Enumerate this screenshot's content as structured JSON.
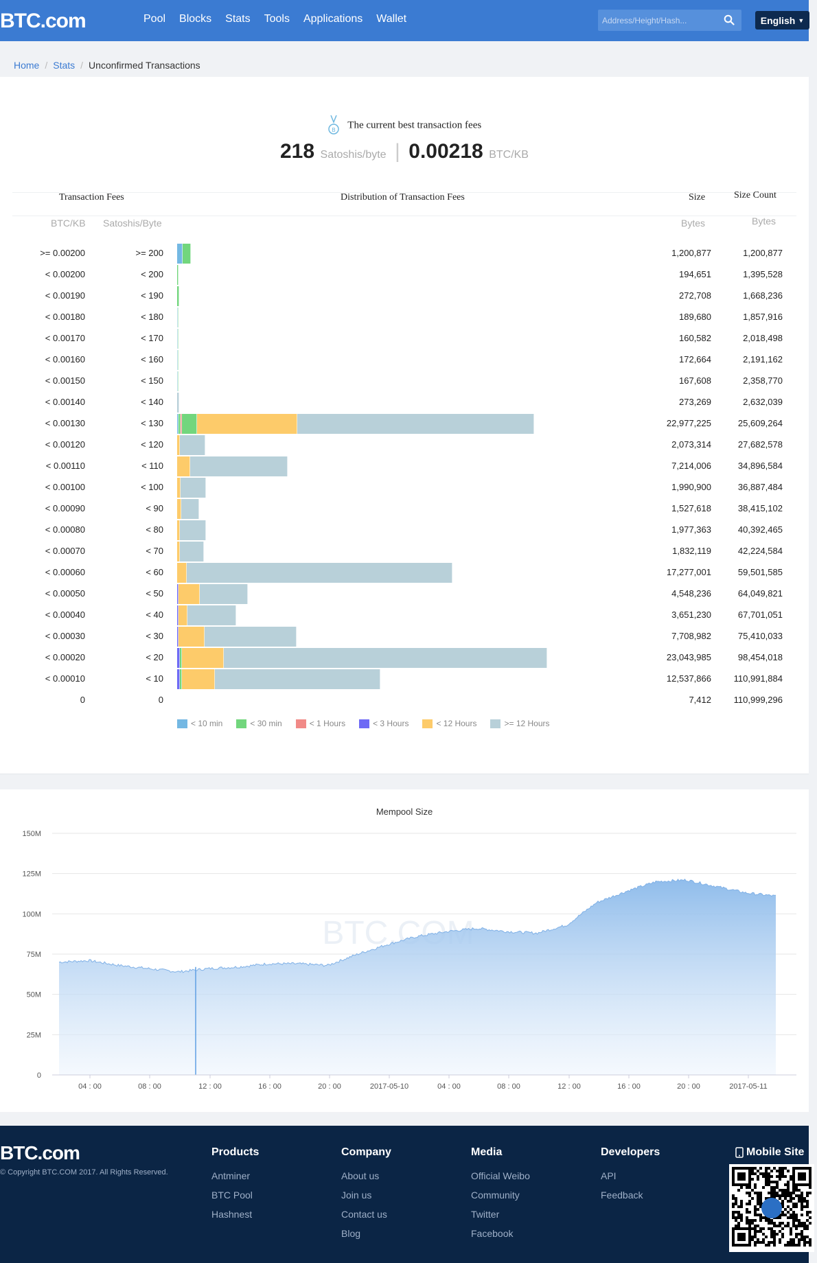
{
  "header": {
    "logo": "BTC.com",
    "nav": [
      "Pool",
      "Blocks",
      "Stats",
      "Tools",
      "Applications",
      "Wallet"
    ],
    "search_placeholder": "Address/Height/Hash...",
    "language": "English"
  },
  "breadcrumb": {
    "home": "Home",
    "stats": "Stats",
    "current": "Unconfirmed Transactions"
  },
  "best_fee": {
    "label": "The current best transaction fees",
    "satoshi_value": "218",
    "satoshi_unit": "Satoshis/byte",
    "btc_value": "0.00218",
    "btc_unit": "BTC/KB"
  },
  "table": {
    "headers": {
      "fees": "Transaction Fees",
      "distribution": "Distribution of Transaction Fees",
      "size": "Size",
      "size_count": "Size Count"
    },
    "subheaders": {
      "btc_kb": "BTC/KB",
      "sat_byte": "Satoshis/Byte",
      "size_unit": "Bytes",
      "count_unit": "Bytes"
    },
    "rows": [
      {
        "btc": ">= 0.00200",
        "sat": ">= 200",
        "size": "1,200,877",
        "count": "1,200,877",
        "segs": [
          8,
          0,
          0,
          0,
          0,
          0,
          0,
          12,
          0,
          0,
          0,
          0
        ]
      },
      {
        "btc": "< 0.00200",
        "sat": "< 200",
        "size": "194,651",
        "count": "1,395,528",
        "segs": [
          0,
          0,
          0,
          2,
          0,
          0,
          0,
          0,
          0,
          0,
          0,
          0
        ]
      },
      {
        "btc": "< 0.00190",
        "sat": "< 190",
        "size": "272,708",
        "count": "1,668,236",
        "segs": [
          0,
          0,
          0,
          3,
          0,
          0,
          0,
          0,
          0,
          0,
          0,
          0
        ]
      },
      {
        "btc": "< 0.00180",
        "sat": "< 180",
        "size": "189,680",
        "count": "1,857,916",
        "segs": [
          1,
          0,
          0,
          1,
          0,
          0,
          0,
          0,
          0,
          0,
          0,
          0
        ]
      },
      {
        "btc": "< 0.00170",
        "sat": "< 170",
        "size": "160,582",
        "count": "2,018,498",
        "segs": [
          1,
          0,
          0,
          1,
          0,
          0,
          0,
          0,
          0,
          0,
          0,
          0
        ]
      },
      {
        "btc": "< 0.00160",
        "sat": "< 160",
        "size": "172,664",
        "count": "2,191,162",
        "segs": [
          1,
          0,
          0,
          1,
          0,
          0,
          0,
          0,
          0,
          0,
          0,
          0
        ]
      },
      {
        "btc": "< 0.00150",
        "sat": "< 150",
        "size": "167,608",
        "count": "2,358,770",
        "segs": [
          1,
          0,
          0,
          1,
          0,
          0,
          0,
          0,
          0,
          0,
          0,
          0
        ]
      },
      {
        "btc": "< 0.00140",
        "sat": "< 140",
        "size": "273,269",
        "count": "2,632,039",
        "segs": [
          0,
          0,
          0,
          0,
          0,
          0,
          0,
          0,
          0,
          0,
          0,
          3
        ]
      },
      {
        "btc": "< 0.00130",
        "sat": "< 130",
        "size": "22,977,225",
        "count": "25,609,264",
        "segs": [
          2,
          0,
          0,
          3,
          0,
          2,
          0,
          22,
          0,
          148,
          0,
          349
        ]
      },
      {
        "btc": "< 0.00120",
        "sat": "< 120",
        "size": "2,073,314",
        "count": "27,682,578",
        "segs": [
          0,
          0,
          0,
          0,
          0,
          0,
          0,
          0,
          0,
          4,
          0,
          37
        ]
      },
      {
        "btc": "< 0.00110",
        "sat": "< 110",
        "size": "7,214,006",
        "count": "34,896,584",
        "segs": [
          0,
          0,
          0,
          0,
          0,
          0,
          0,
          0,
          0,
          19,
          0,
          144
        ]
      },
      {
        "btc": "< 0.00100",
        "sat": "< 100",
        "size": "1,990,900",
        "count": "36,887,484",
        "segs": [
          0,
          0,
          0,
          0,
          0,
          0,
          0,
          0,
          0,
          5,
          0,
          37
        ]
      },
      {
        "btc": "< 0.00090",
        "sat": "< 90",
        "size": "1,527,618",
        "count": "38,415,102",
        "segs": [
          0,
          0,
          0,
          0,
          0,
          0,
          0,
          0,
          0,
          6,
          0,
          26
        ]
      },
      {
        "btc": "< 0.00080",
        "sat": "< 80",
        "size": "1,977,363",
        "count": "40,392,465",
        "segs": [
          0,
          0,
          0,
          0,
          0,
          0,
          0,
          0,
          0,
          4,
          0,
          38
        ]
      },
      {
        "btc": "< 0.00070",
        "sat": "< 70",
        "size": "1,832,119",
        "count": "42,224,584",
        "segs": [
          0,
          0,
          0,
          0,
          0,
          0,
          0,
          0,
          0,
          4,
          0,
          35
        ]
      },
      {
        "btc": "< 0.00060",
        "sat": "< 60",
        "size": "17,277,001",
        "count": "59,501,585",
        "segs": [
          0,
          0,
          0,
          0,
          0,
          0,
          0,
          0,
          0,
          14,
          0,
          392
        ]
      },
      {
        "btc": "< 0.00050",
        "sat": "< 50",
        "size": "4,548,236",
        "count": "64,049,821",
        "segs": [
          0,
          0,
          0,
          0,
          0,
          0,
          2,
          0,
          0,
          31,
          0,
          71
        ]
      },
      {
        "btc": "< 0.00040",
        "sat": "< 40",
        "size": "3,651,230",
        "count": "67,701,051",
        "segs": [
          0,
          0,
          0,
          0,
          0,
          0,
          2,
          0,
          0,
          13,
          0,
          72
        ]
      },
      {
        "btc": "< 0.00030",
        "sat": "< 30",
        "size": "7,708,982",
        "count": "75,410,033",
        "segs": [
          0,
          0,
          0,
          0,
          0,
          0,
          2,
          0,
          0,
          38,
          0,
          136
        ]
      },
      {
        "btc": "< 0.00020",
        "sat": "< 20",
        "size": "23,043,985",
        "count": "98,454,018",
        "segs": [
          0,
          0,
          0,
          0,
          0,
          0,
          4,
          3,
          0,
          62,
          0,
          476
        ]
      },
      {
        "btc": "< 0.00010",
        "sat": "< 10",
        "size": "12,537,866",
        "count": "110,991,884",
        "segs": [
          0,
          0,
          0,
          0,
          0,
          0,
          4,
          3,
          0,
          49,
          0,
          243
        ]
      },
      {
        "btc": "0",
        "sat": "0",
        "size": "7,412",
        "count": "110,999,296",
        "segs": [
          0,
          0,
          0,
          0,
          0,
          0,
          0,
          0,
          0,
          0,
          0,
          0
        ]
      }
    ]
  },
  "legend": [
    {
      "label": "< 10 min",
      "color": "#74b8e3"
    },
    {
      "label": "< 30 min",
      "color": "#72d67d"
    },
    {
      "label": "< 1 Hours",
      "color": "#f18a87"
    },
    {
      "label": "< 3 Hours",
      "color": "#6e6af5"
    },
    {
      "label": "< 12 Hours",
      "color": "#fdcb6a"
    },
    {
      "label": ">= 12 Hours",
      "color": "#b8d0d9"
    }
  ],
  "mempool": {
    "title": "Mempool Size",
    "watermark": "BTC.COM",
    "y_ticks": [
      "150M",
      "125M",
      "100M",
      "75M",
      "50M",
      "25M",
      "0"
    ],
    "x_ticks": [
      "04 : 00",
      "08 : 00",
      "12 : 00",
      "16 : 00",
      "20 : 00",
      "2017-05-10",
      "04 : 00",
      "08 : 00",
      "12 : 00",
      "16 : 00",
      "20 : 00",
      "2017-05-11"
    ]
  },
  "chart_data": {
    "type": "area",
    "title": "Mempool Size",
    "ylim": [
      0,
      150
    ],
    "y_unit": "M",
    "x": [
      "02:00",
      "04:00",
      "06:00",
      "08:00",
      "10:00",
      "12:00",
      "14:00",
      "16:00",
      "18:00",
      "20:00",
      "22:00",
      "00:00",
      "02:00",
      "04:00",
      "06:00",
      "08:00",
      "10:00",
      "12:00",
      "14:00",
      "16:00",
      "18:00",
      "20:00",
      "22:00",
      "00:00",
      "01:30"
    ],
    "values": [
      70,
      71,
      68,
      66,
      64,
      66,
      67,
      69,
      69,
      68,
      75,
      81,
      86,
      89,
      91,
      89,
      88,
      93,
      107,
      114,
      120,
      121,
      117,
      113,
      111
    ],
    "series_color": "#8ab9ea"
  },
  "footer": {
    "logo": "BTC.com",
    "copyright": "© Copyright BTC.COM 2017. All Rights Reserved.",
    "mobile_site": "Mobile Site",
    "columns": [
      {
        "title": "Products",
        "links": [
          "Antminer",
          "BTC Pool",
          "Hashnest"
        ]
      },
      {
        "title": "Company",
        "links": [
          "About us",
          "Join us",
          "Contact us",
          "Blog"
        ]
      },
      {
        "title": "Media",
        "links": [
          "Official Weibo",
          "Community",
          "Twitter",
          "Facebook"
        ]
      },
      {
        "title": "Developers",
        "links": [
          "API",
          "Feedback"
        ]
      }
    ]
  }
}
